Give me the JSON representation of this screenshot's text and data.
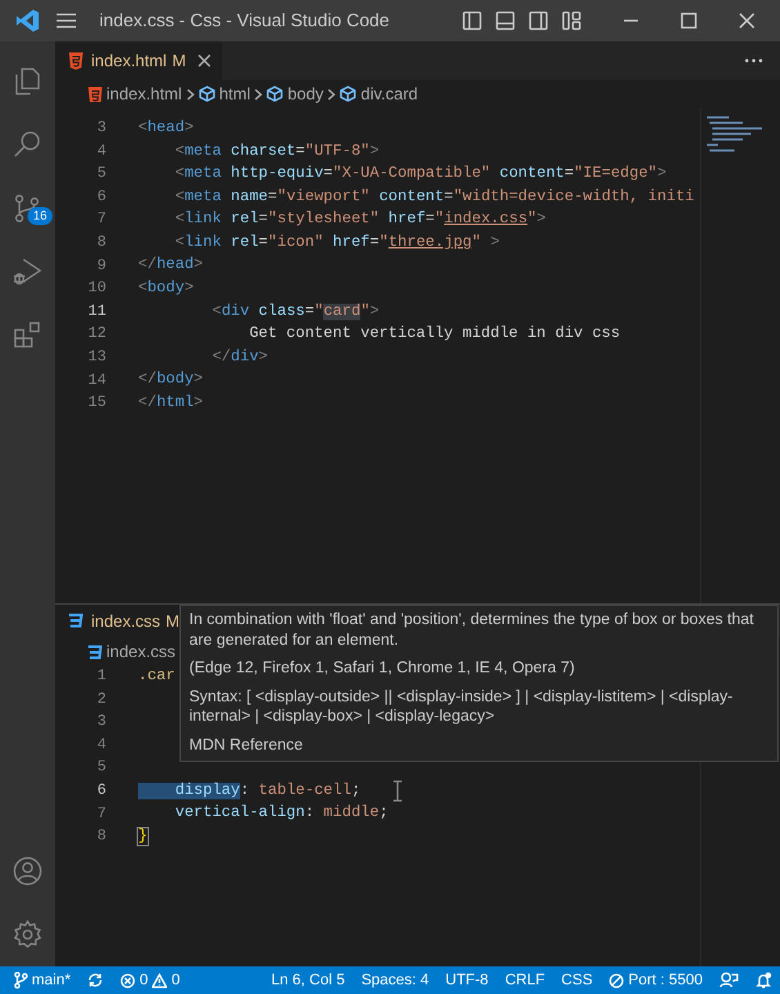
{
  "window": {
    "title": "index.css - Css - Visual Studio Code"
  },
  "activity_bar": {
    "items": [
      {
        "kind": "files",
        "selected": false
      },
      {
        "kind": "search",
        "selected": false
      },
      {
        "kind": "source-control",
        "selected": false,
        "badge": "16"
      },
      {
        "kind": "run-debug",
        "selected": false
      },
      {
        "kind": "extensions",
        "selected": false
      }
    ],
    "bottom": [
      {
        "kind": "account"
      },
      {
        "kind": "settings"
      }
    ]
  },
  "editors": [
    {
      "tab": {
        "label": "index.html",
        "modified": "M",
        "kind": "html",
        "selected": true
      },
      "breadcrumbs": [
        {
          "kind": "html",
          "text": "index.html"
        },
        {
          "kind": "element",
          "text": "html"
        },
        {
          "kind": "element",
          "text": "body"
        },
        {
          "kind": "element",
          "text": "div.card"
        }
      ],
      "lines": [
        {
          "number": "3",
          "current": false,
          "tokens": [
            {
              "kind": "punct",
              "text": "<"
            },
            {
              "kind": "tag",
              "text": "head"
            },
            {
              "kind": "punct",
              "text": ">"
            }
          ]
        },
        {
          "number": "4",
          "current": false,
          "tokens": [
            {
              "kind": "punct",
              "text": "    <"
            },
            {
              "kind": "tag",
              "text": "meta"
            },
            {
              "kind": "attr",
              "text": " charset"
            },
            {
              "kind": "plain",
              "text": "="
            },
            {
              "kind": "string",
              "text": "\"UTF-8\""
            },
            {
              "kind": "punct",
              "text": ">"
            }
          ]
        },
        {
          "number": "5",
          "current": false,
          "tokens": [
            {
              "kind": "punct",
              "text": "    <"
            },
            {
              "kind": "tag",
              "text": "meta"
            },
            {
              "kind": "attr",
              "text": " http-equiv"
            },
            {
              "kind": "plain",
              "text": "="
            },
            {
              "kind": "string",
              "text": "\"X-UA-Compatible\""
            },
            {
              "kind": "attr",
              "text": " content"
            },
            {
              "kind": "plain",
              "text": "="
            },
            {
              "kind": "string",
              "text": "\"IE=edge\""
            },
            {
              "kind": "punct",
              "text": ">"
            }
          ]
        },
        {
          "number": "6",
          "current": false,
          "tokens": [
            {
              "kind": "punct",
              "text": "    <"
            },
            {
              "kind": "tag",
              "text": "meta"
            },
            {
              "kind": "attr",
              "text": " name"
            },
            {
              "kind": "plain",
              "text": "="
            },
            {
              "kind": "string",
              "text": "\"viewport\""
            },
            {
              "kind": "attr",
              "text": " content"
            },
            {
              "kind": "plain",
              "text": "="
            },
            {
              "kind": "string",
              "text": "\"width=device-width, initi"
            }
          ]
        },
        {
          "number": "7",
          "current": false,
          "tokens": [
            {
              "kind": "punct",
              "text": "    <"
            },
            {
              "kind": "tag",
              "text": "link"
            },
            {
              "kind": "attr",
              "text": " rel"
            },
            {
              "kind": "plain",
              "text": "="
            },
            {
              "kind": "string",
              "text": "\"stylesheet\""
            },
            {
              "kind": "attr",
              "text": " href"
            },
            {
              "kind": "plain",
              "text": "="
            },
            {
              "kind": "string",
              "text": "\""
            },
            {
              "kind": "link",
              "text": "index.css"
            },
            {
              "kind": "string",
              "text": "\""
            },
            {
              "kind": "punct",
              "text": ">"
            }
          ]
        },
        {
          "number": "8",
          "current": false,
          "tokens": [
            {
              "kind": "punct",
              "text": "    <"
            },
            {
              "kind": "tag",
              "text": "link"
            },
            {
              "kind": "attr",
              "text": " rel"
            },
            {
              "kind": "plain",
              "text": "="
            },
            {
              "kind": "string",
              "text": "\"icon\""
            },
            {
              "kind": "attr",
              "text": " href"
            },
            {
              "kind": "plain",
              "text": "="
            },
            {
              "kind": "string",
              "text": "\""
            },
            {
              "kind": "link",
              "text": "three.jpg"
            },
            {
              "kind": "string",
              "text": "\""
            },
            {
              "kind": "punct",
              "text": " >"
            }
          ]
        },
        {
          "number": "9",
          "current": false,
          "tokens": [
            {
              "kind": "punct",
              "text": "</"
            },
            {
              "kind": "tag",
              "text": "head"
            },
            {
              "kind": "punct",
              "text": ">"
            }
          ]
        },
        {
          "number": "10",
          "current": false,
          "tokens": [
            {
              "kind": "punct",
              "text": "<"
            },
            {
              "kind": "tag",
              "text": "body"
            },
            {
              "kind": "punct",
              "text": ">"
            }
          ]
        },
        {
          "number": "11",
          "current": true,
          "tokens": [
            {
              "kind": "punct",
              "text": "        <"
            },
            {
              "kind": "tag",
              "text": "div"
            },
            {
              "kind": "attr",
              "text": " class"
            },
            {
              "kind": "plain",
              "text": "="
            },
            {
              "kind": "string",
              "text": "\""
            },
            {
              "kind": "string-hl",
              "text": "card"
            },
            {
              "kind": "string",
              "text": "\""
            },
            {
              "kind": "punct",
              "text": ">"
            }
          ]
        },
        {
          "number": "12",
          "current": false,
          "tokens": [
            {
              "kind": "plain",
              "text": "            Get content vertically middle in div css"
            }
          ]
        },
        {
          "number": "13",
          "current": false,
          "tokens": [
            {
              "kind": "punct",
              "text": "        </"
            },
            {
              "kind": "tag",
              "text": "div"
            },
            {
              "kind": "punct",
              "text": ">"
            }
          ]
        },
        {
          "number": "14",
          "current": false,
          "tokens": [
            {
              "kind": "punct",
              "text": "</"
            },
            {
              "kind": "tag",
              "text": "body"
            },
            {
              "kind": "punct",
              "text": ">"
            }
          ]
        },
        {
          "number": "15",
          "current": false,
          "tokens": [
            {
              "kind": "punct",
              "text": "</"
            },
            {
              "kind": "tag",
              "text": "html"
            },
            {
              "kind": "punct",
              "text": ">"
            }
          ]
        }
      ]
    },
    {
      "tab": {
        "label": "index.css",
        "modified": "M",
        "kind": "css",
        "selected": true
      },
      "breadcrumbs": [
        {
          "kind": "css",
          "text": "index.css"
        }
      ],
      "lines": [
        {
          "number": "1",
          "current": false,
          "tokens": [
            {
              "kind": "selector",
              "text": ".car"
            }
          ]
        },
        {
          "number": "2",
          "current": false
        },
        {
          "number": "3",
          "current": false
        },
        {
          "number": "4",
          "current": false
        },
        {
          "number": "5",
          "current": false
        },
        {
          "number": "6",
          "current": true,
          "tokens": [
            {
              "kind": "prop-hl",
              "text": "    display"
            },
            {
              "kind": "plain",
              "text": ": "
            },
            {
              "kind": "value",
              "text": "table-cell"
            },
            {
              "kind": "plain",
              "text": ";"
            }
          ]
        },
        {
          "number": "7",
          "current": false,
          "tokens": [
            {
              "kind": "prop",
              "text": "    vertical-align"
            },
            {
              "kind": "plain",
              "text": ": "
            },
            {
              "kind": "value",
              "text": "middle"
            },
            {
              "kind": "plain",
              "text": ";"
            }
          ]
        },
        {
          "number": "8",
          "current": false,
          "tokens": [
            {
              "kind": "bracket",
              "text": "}"
            }
          ]
        }
      ],
      "hover": {
        "description": "In combination with 'float' and 'position', determines the type of box or boxes that are generated for an element.",
        "browsers": "(Edge 12, Firefox 1, Safari 1, Chrome 1, IE 4, Opera 7)",
        "syntax": "Syntax: [ <display-outside> || <display-inside> ] | <display-listitem> | <display-internal> | <display-box> | <display-legacy>",
        "link": "MDN Reference"
      }
    }
  ],
  "status_bar": {
    "left": [
      {
        "kind": "branch",
        "text": "main*"
      },
      {
        "kind": "sync"
      },
      {
        "kind": "problems",
        "errors": "0",
        "warnings": "0"
      }
    ],
    "right": [
      {
        "kind": "text",
        "text": "Ln 6, Col 5"
      },
      {
        "kind": "text",
        "text": "Spaces: 4"
      },
      {
        "kind": "text",
        "text": "UTF-8"
      },
      {
        "kind": "text",
        "text": "CRLF"
      },
      {
        "kind": "text",
        "text": "CSS"
      },
      {
        "kind": "port",
        "text": "Port : 5500"
      },
      {
        "kind": "feedback"
      },
      {
        "kind": "bell"
      }
    ]
  }
}
